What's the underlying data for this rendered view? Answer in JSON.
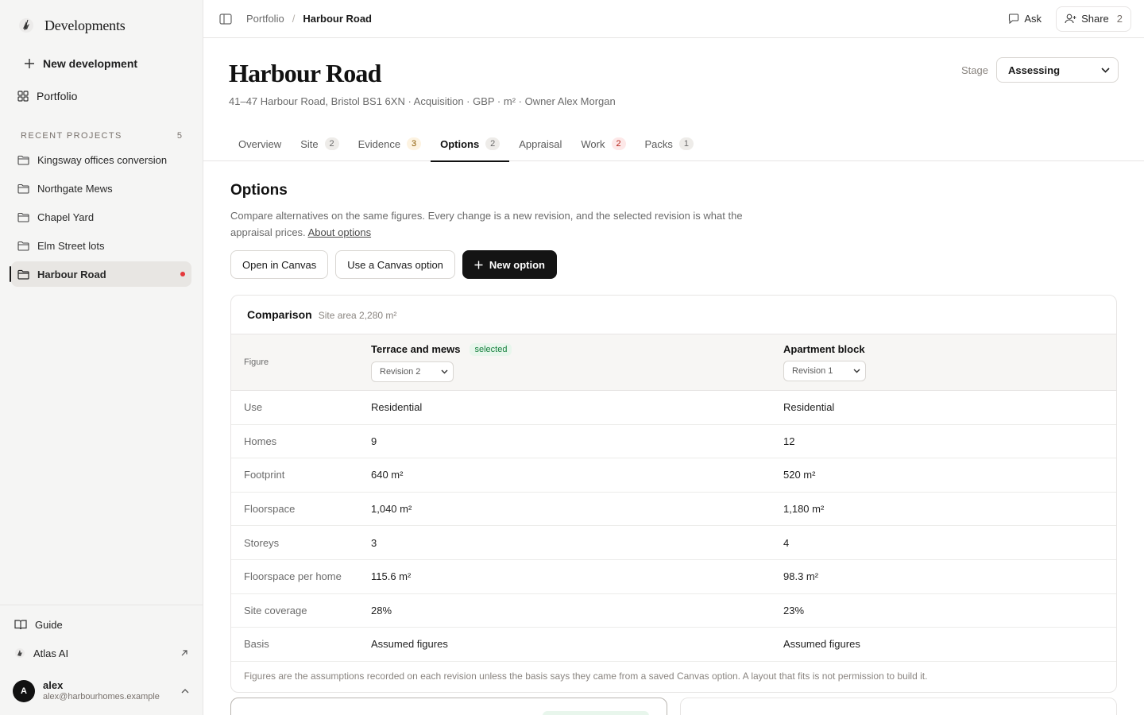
{
  "app": {
    "name": "Developments"
  },
  "sidebar": {
    "new_label": "New development",
    "portfolio_label": "Portfolio",
    "recent_heading": "RECENT PROJECTS",
    "recent_count": "5",
    "projects": [
      {
        "label": "Kingsway offices conversion"
      },
      {
        "label": "Northgate Mews"
      },
      {
        "label": "Chapel Yard"
      },
      {
        "label": "Elm Street lots"
      },
      {
        "label": "Harbour Road"
      }
    ],
    "guide_label": "Guide",
    "ai_label": "Atlas AI",
    "user": {
      "initial": "A",
      "name": "alex",
      "email": "alex@harbourhomes.example"
    }
  },
  "topbar": {
    "crumb_root": "Portfolio",
    "crumb_sep": "/",
    "crumb_current": "Harbour Road",
    "ask_label": "Ask",
    "share_label": "Share",
    "share_count": "2"
  },
  "header": {
    "title": "Harbour Road",
    "subtitle": "41–47 Harbour Road, Bristol BS1 6XN · Acquisition · GBP · m² · Owner Alex Morgan",
    "stage_label": "Stage",
    "stage_value": "Assessing"
  },
  "tabs": [
    {
      "label": "Overview",
      "badge": ""
    },
    {
      "label": "Site",
      "badge": "2"
    },
    {
      "label": "Evidence",
      "badge": "3"
    },
    {
      "label": "Options",
      "badge": "2"
    },
    {
      "label": "Appraisal",
      "badge": ""
    },
    {
      "label": "Work",
      "badge": "2"
    },
    {
      "label": "Packs",
      "badge": "1"
    }
  ],
  "options": {
    "heading": "Options",
    "description": "Compare alternatives on the same figures. Every change is a new revision, and the selected revision is what the appraisal prices.",
    "about_link": "About options",
    "btn_canvas": "Open in Canvas",
    "btn_use_canvas": "Use a Canvas option",
    "btn_new": "New option"
  },
  "comparison": {
    "title": "Comparison",
    "meta": "Site area 2,280 m²",
    "figure_header": "Figure",
    "option_a": {
      "name": "Terrace and mews",
      "badge": "selected",
      "revision": "Revision 2"
    },
    "option_b": {
      "name": "Apartment block",
      "revision": "Revision 1"
    },
    "rows": [
      {
        "label": "Use",
        "a": "Residential",
        "b": "Residential"
      },
      {
        "label": "Homes",
        "a": "9",
        "b": "12"
      },
      {
        "label": "Footprint",
        "a": "640 m²",
        "b": "520 m²"
      },
      {
        "label": "Floorspace",
        "a": "1,040 m²",
        "b": "1,180 m²"
      },
      {
        "label": "Storeys",
        "a": "3",
        "b": "4"
      },
      {
        "label": "Floorspace per home",
        "a": "115.6 m²",
        "b": "98.3 m²"
      },
      {
        "label": "Site coverage",
        "a": "28%",
        "b": "23%"
      },
      {
        "label": "Basis",
        "a": "Assumed figures",
        "b": "Assumed figures"
      }
    ],
    "note": "Figures are the assumptions recorded on each revision unless the basis says they came from a saved Canvas option. A layout that fits is not permission to build it."
  }
}
